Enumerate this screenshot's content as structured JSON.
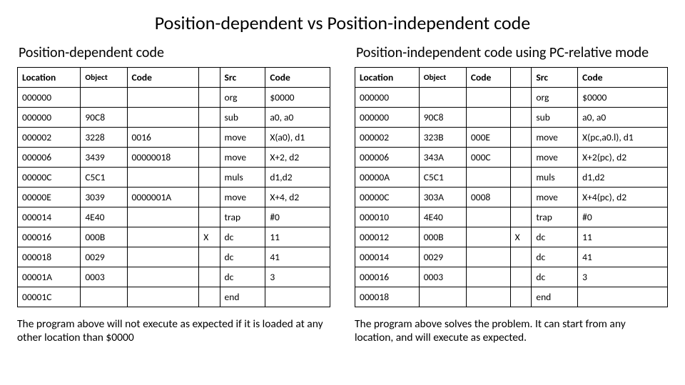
{
  "title": "Position-dependent vs Position-independent code",
  "left": {
    "heading": "Position-dependent code",
    "headers": [
      "Location",
      "Object",
      "Code",
      "",
      "Src",
      "Code"
    ],
    "rows": [
      [
        "000000",
        "",
        "",
        "",
        "org",
        "$0000"
      ],
      [
        "000000",
        "90C8",
        "",
        "",
        "sub",
        "a0, a0"
      ],
      [
        "000002",
        "3228",
        "0016",
        "",
        "move",
        "X(a0), d1"
      ],
      [
        "000006",
        "3439",
        "00000018",
        "",
        "move",
        "X+2, d2"
      ],
      [
        "00000C",
        "C5C1",
        "",
        "",
        "muls",
        "d1,d2"
      ],
      [
        "00000E",
        "3039",
        "0000001A",
        "",
        "move",
        "X+4, d2"
      ],
      [
        "000014",
        "4E40",
        "",
        "",
        "trap",
        "#0"
      ],
      [
        "000016",
        "000B",
        "",
        "X",
        "dc",
        "11"
      ],
      [
        "000018",
        "0029",
        "",
        "",
        "dc",
        "41"
      ],
      [
        "00001A",
        "0003",
        "",
        "",
        "dc",
        "3"
      ],
      [
        "00001C",
        "",
        "",
        "",
        "end",
        ""
      ]
    ],
    "caption": "The program above will not execute as expected if it is loaded at any other location than $0000"
  },
  "right": {
    "heading": "Position-independent code using PC-relative mode",
    "headers": [
      "Location",
      "Object",
      "Code",
      "",
      "Src",
      "Code"
    ],
    "rows": [
      [
        "000000",
        "",
        "",
        "",
        "org",
        "$0000"
      ],
      [
        "000000",
        "90C8",
        "",
        "",
        "sub",
        "a0, a0"
      ],
      [
        "000002",
        "323B",
        "000E",
        "",
        "move",
        "X(pc,a0.l), d1"
      ],
      [
        "000006",
        "343A",
        "000C",
        "",
        "move",
        "X+2(pc), d2"
      ],
      [
        "00000A",
        "C5C1",
        "",
        "",
        "muls",
        "d1,d2"
      ],
      [
        "00000C",
        "303A",
        "0008",
        "",
        "move",
        "X+4(pc), d2"
      ],
      [
        "000010",
        "4E40",
        "",
        "",
        "trap",
        "#0"
      ],
      [
        "000012",
        "000B",
        "",
        "X",
        "dc",
        "11"
      ],
      [
        "000014",
        "0029",
        "",
        "",
        "dc",
        "41"
      ],
      [
        "000016",
        "0003",
        "",
        "",
        "dc",
        "3"
      ],
      [
        "000018",
        "",
        "",
        "",
        "end",
        ""
      ]
    ],
    "caption": "The program above solves the problem. It can start from any location, and will execute as expected."
  }
}
